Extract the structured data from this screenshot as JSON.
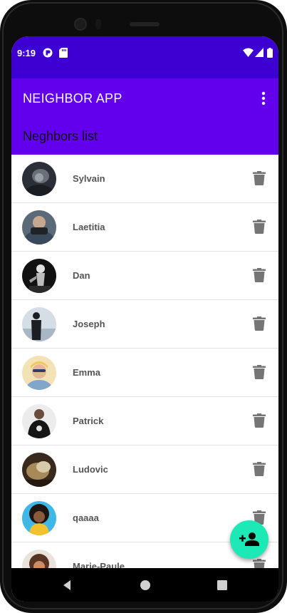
{
  "status_bar": {
    "time": "9:19",
    "left_icons": [
      "notification-badge-icon",
      "sd-card-icon"
    ],
    "right_icons": [
      "wifi-icon",
      "signal-icon",
      "battery-icon"
    ]
  },
  "app_bar": {
    "title": "NEIGHBOR APP",
    "section_title": "Neghbors list",
    "color": "#6200ee",
    "status_color": "#3d00d3"
  },
  "neighbors": [
    {
      "name": "Sylvain"
    },
    {
      "name": "Laetitia"
    },
    {
      "name": "Dan"
    },
    {
      "name": "Joseph"
    },
    {
      "name": "Emma"
    },
    {
      "name": "Patrick"
    },
    {
      "name": "Ludovic"
    },
    {
      "name": "qaaaa"
    },
    {
      "name": "Marie-Paule"
    }
  ],
  "fab": {
    "icon": "person-add-icon",
    "color": "#1de9b6"
  },
  "nav_bar": [
    "back-icon",
    "home-icon",
    "recents-icon"
  ]
}
